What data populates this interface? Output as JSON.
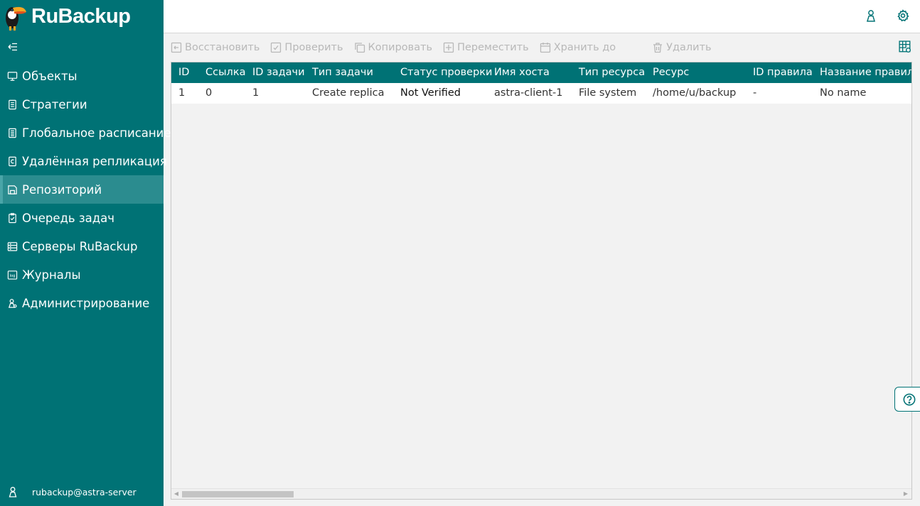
{
  "app": {
    "logo_text_ru": "Ru",
    "logo_text_rest": "Backup"
  },
  "sidebar": {
    "items": [
      {
        "label": "Объекты",
        "icon": "monitor-icon"
      },
      {
        "label": "Стратегии",
        "icon": "document-icon"
      },
      {
        "label": "Глобальное расписание",
        "icon": "schedule-icon"
      },
      {
        "label": "Удалённая репликация",
        "icon": "replication-icon"
      },
      {
        "label": "Репозиторий",
        "icon": "repository-icon",
        "active": true
      },
      {
        "label": "Очередь задач",
        "icon": "task-queue-icon"
      },
      {
        "label": "Серверы RuBackup",
        "icon": "servers-icon"
      },
      {
        "label": "Журналы",
        "icon": "log-icon"
      },
      {
        "label": "Администрирование",
        "icon": "admin-icon"
      }
    ],
    "user": "rubackup@astra-server",
    "log_icon_text": "log"
  },
  "toolbar": {
    "restore": "Восстановить",
    "verify": "Проверить",
    "copy": "Копировать",
    "move": "Переместить",
    "keep_until": "Хранить до",
    "delete": "Удалить"
  },
  "table": {
    "columns": [
      "ID",
      "Ссылка",
      "ID задачи",
      "Тип задачи",
      "Статус проверки",
      "Имя хоста",
      "Тип ресурса",
      "Ресурс",
      "ID правила",
      "Название правила"
    ],
    "rows": [
      [
        "1",
        "0",
        "1",
        "Create replica",
        "Not Verified",
        "astra-client-1",
        "File system",
        "/home/u/backup",
        "-",
        "No name"
      ]
    ]
  },
  "scroll": {
    "left_arrow": "◀",
    "right_arrow": "▶"
  },
  "colors": {
    "sidebar": "#007275",
    "active_item": "#2b8c8f",
    "header": "#007275",
    "background": "#f2f2f2"
  }
}
